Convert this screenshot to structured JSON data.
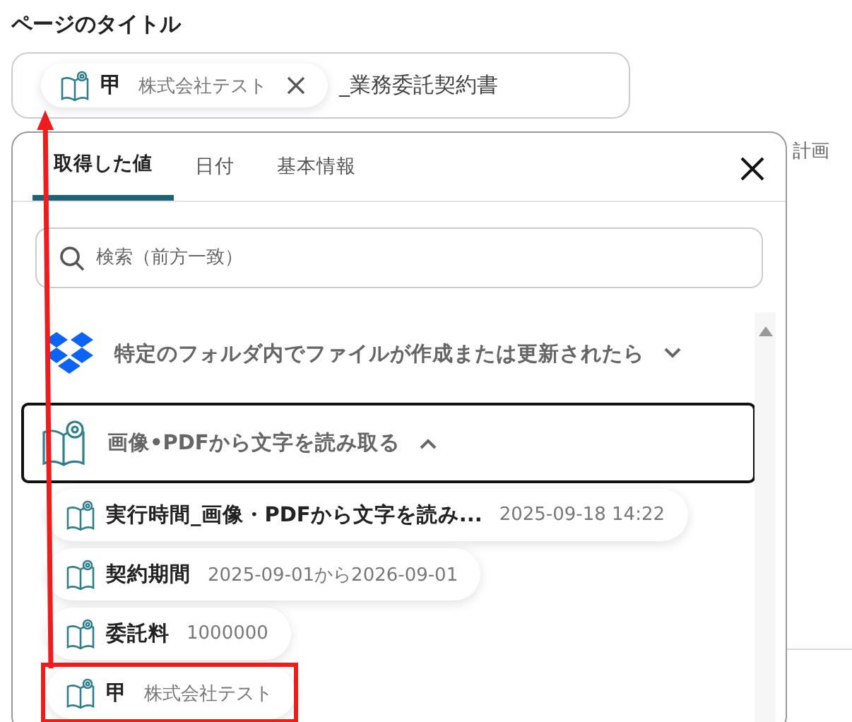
{
  "page_title_label": "ページのタイトル",
  "title_field": {
    "chip": {
      "name": "甲",
      "value": "株式会社テスト"
    },
    "text": "_業務委託契約書"
  },
  "background_text": "計画",
  "popup": {
    "tabs": [
      {
        "label": "取得した値",
        "selected": true
      },
      {
        "label": "日付",
        "selected": false
      },
      {
        "label": "基本情報",
        "selected": false
      }
    ],
    "search": {
      "placeholder": "検索（前方一致）"
    },
    "groups": [
      {
        "kind": "dropbox",
        "title": "特定のフォルダ内でファイルが作成または更新されたら",
        "expanded": false
      },
      {
        "kind": "ocr",
        "title": "画像•PDFから文字を読み取る",
        "expanded": true,
        "items": [
          {
            "name": "実行時間_画像・PDFから文字を読み...",
            "value": "2025-09-18 14:22",
            "highlighted": false
          },
          {
            "name": "契約期間",
            "value": "2025-09-01から2026-09-01",
            "highlighted": false
          },
          {
            "name": "委託料",
            "value": "1000000",
            "highlighted": false
          },
          {
            "name": "甲",
            "value": "株式会社テスト",
            "highlighted": true
          }
        ]
      }
    ]
  }
}
